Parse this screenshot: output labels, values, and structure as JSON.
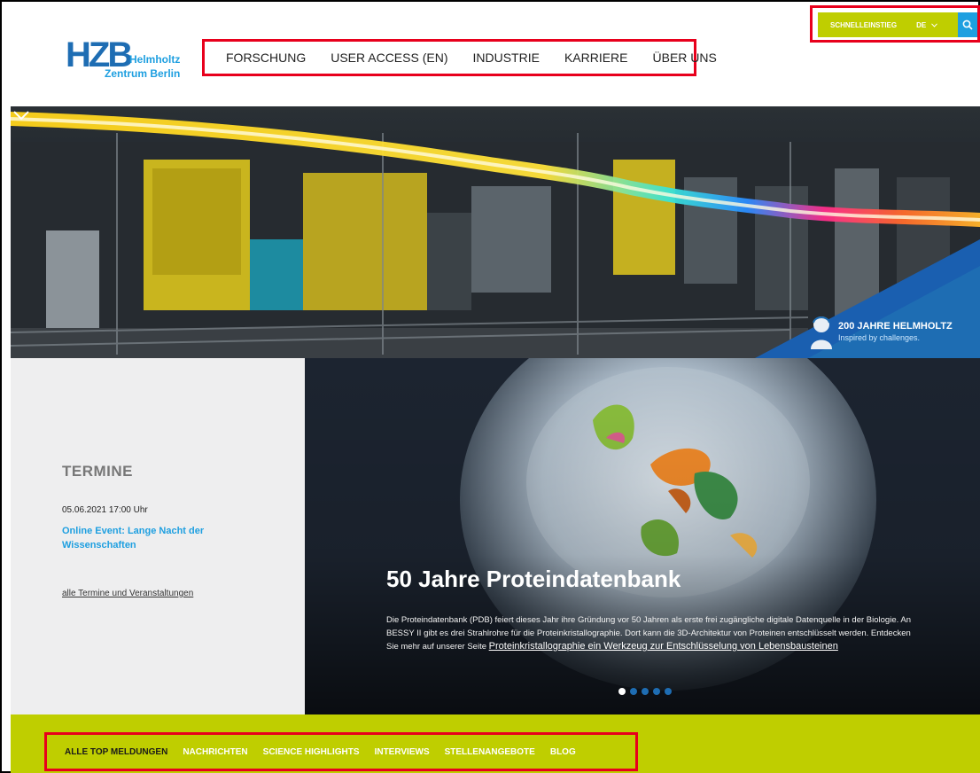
{
  "logo": {
    "mark": "HZB",
    "line1": "Helmholtz",
    "line2": "Zentrum Berlin"
  },
  "nav": {
    "items": [
      {
        "label": "FORSCHUNG"
      },
      {
        "label": "USER ACCESS (EN)"
      },
      {
        "label": "INDUSTRIE"
      },
      {
        "label": "KARRIERE"
      },
      {
        "label": "ÜBER UNS"
      }
    ]
  },
  "utility": {
    "quick_access": "SCHNELLEINSTIEG",
    "language": "DE",
    "search_icon": "search-icon"
  },
  "hero": {
    "badge_title": "200 JAHRE HELMHOLTZ",
    "badge_subtitle": "Inspired by challenges.",
    "scroll_icon": "chevron-down-icon"
  },
  "events": {
    "title": "TERMINE",
    "date": "05.06.2021 17:00 Uhr",
    "event_link": "Online Event: Lange Nacht der Wissenschaften",
    "all_link": "alle Termine und Veranstaltungen"
  },
  "feature": {
    "title": "50 Jahre Proteindatenbank",
    "body": "Die Proteindatenbank (PDB) feiert dieses Jahr ihre Gründung vor 50 Jahren als erste frei zugängliche digitale Datenquelle in der Biologie. An BESSY II gibt es drei Strahlrohre für die Proteinkristallographie. Dort kann die 3D-Architektur von Proteinen entschlüsselt werden. Entdecken Sie mehr auf unserer Seite ",
    "link": "Proteinkristallographie ein Werkzeug zur Entschlüsselung von Lebensbausteinen",
    "slide_count": 5,
    "active_slide": 1
  },
  "tabs": {
    "items": [
      {
        "label": "ALLE TOP MELDUNGEN",
        "active": true
      },
      {
        "label": "NACHRICHTEN"
      },
      {
        "label": "SCIENCE HIGHLIGHTS"
      },
      {
        "label": "INTERVIEWS"
      },
      {
        "label": "STELLENANGEBOTE"
      },
      {
        "label": "BLOG"
      }
    ]
  },
  "colors": {
    "brand_blue": "#1e6db3",
    "accent_blue": "#1e9fe0",
    "accent_green": "#bfce00",
    "highlight_red": "#e8001c"
  }
}
